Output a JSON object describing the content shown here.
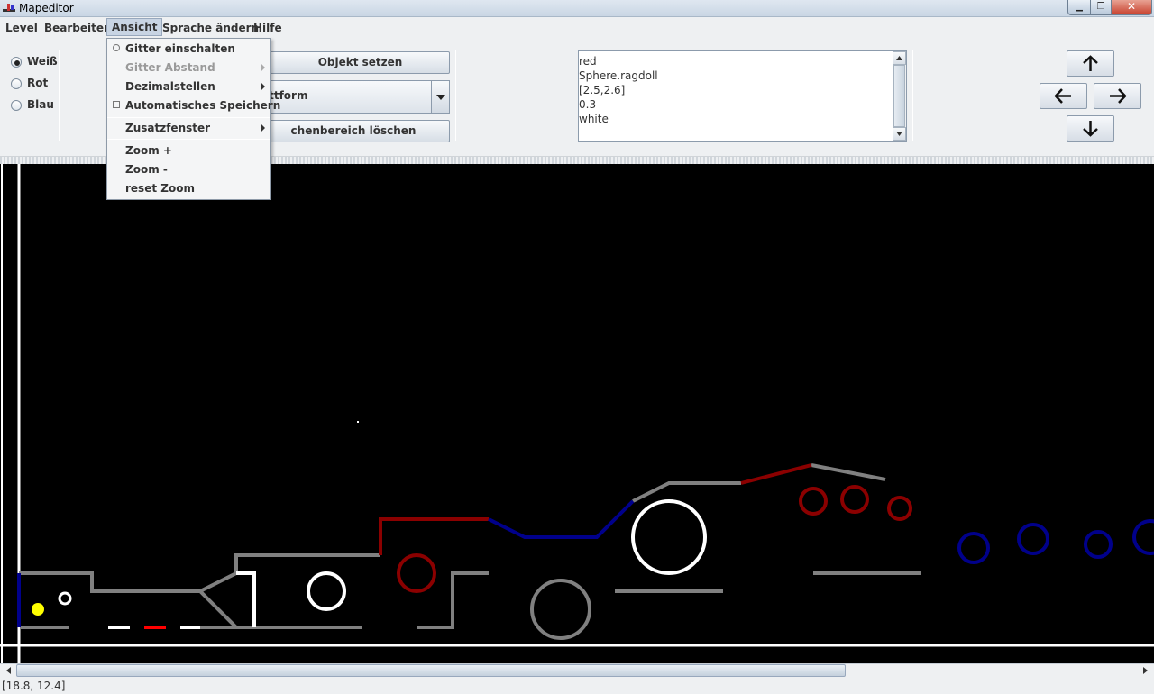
{
  "window": {
    "title": "Mapeditor",
    "min_symbol": "▁",
    "max_symbol": "❐",
    "close_symbol": "✕"
  },
  "menubar": {
    "items": [
      "Level",
      "Bearbeiten",
      "Ansicht",
      "Sprache ändern",
      "Hilfe"
    ],
    "active": "Ansicht"
  },
  "view_menu": {
    "grid_on": "Gitter einschalten",
    "grid_distance": "Gitter Abstand",
    "decimals": "Dezimalstellen",
    "autosave": "Automatisches Speichern",
    "extra_windows": "Zusatzfenster",
    "zoom_in": "Zoom +",
    "zoom_out": "Zoom -",
    "reset_zoom": "reset Zoom"
  },
  "color_options": {
    "white": "Weiß",
    "red": "Rot",
    "blue": "Blau",
    "selected": "Weiß"
  },
  "toolbar": {
    "set_object": "Objekt setzen",
    "object_type": "attform",
    "clear_area": "chenbereich löschen"
  },
  "properties": {
    "lines": [
      "red",
      "Sphere.ragdoll",
      "[2.5,2.6]",
      "0.3",
      "white"
    ]
  },
  "navigation": {
    "up": "↑",
    "left": "←",
    "right": "→",
    "down": "↓"
  },
  "status": {
    "coordinates": "[18.8, 12.4]"
  },
  "colors": {
    "white": "#ffffff",
    "grey": "#808080",
    "dark_red": "#8b0000",
    "blue": "#00008b",
    "yellow": "#ffff00",
    "red": "#ff0000",
    "background": "#000000"
  }
}
